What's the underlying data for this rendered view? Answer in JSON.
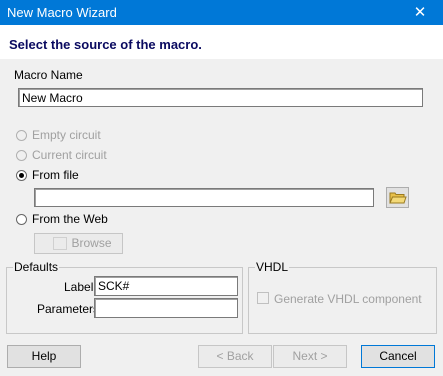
{
  "window": {
    "title": "New Macro Wizard",
    "close_glyph": "✕"
  },
  "heading": "Select the source of the macro.",
  "macro_name": {
    "label": "Macro Name",
    "value": "New Macro"
  },
  "source_options": [
    {
      "label": "Empty circuit",
      "selected": false,
      "enabled": false
    },
    {
      "label": "Current circuit",
      "selected": false,
      "enabled": false
    },
    {
      "label": "From file",
      "selected": true,
      "enabled": true
    },
    {
      "label": "From the Web",
      "selected": false,
      "enabled": true
    }
  ],
  "file_path": {
    "value": ""
  },
  "browse_label": "Browse",
  "defaults": {
    "legend": "Defaults",
    "label_caption": "Label:",
    "label_value": "SCK#",
    "parameters_caption": "Parameters:",
    "parameters_value": ""
  },
  "vhdl": {
    "legend": "VHDL",
    "checkbox_label": "Generate VHDL component",
    "checked": false
  },
  "buttons": {
    "help": "Help",
    "back": "< Back",
    "next": "Next >",
    "cancel": "Cancel"
  },
  "icons": {
    "folder": "folder-open-icon",
    "close": "close-icon"
  },
  "colors": {
    "titlebar": "#0078d7",
    "heading": "#0a0a60",
    "folder": "#e8c04a"
  }
}
